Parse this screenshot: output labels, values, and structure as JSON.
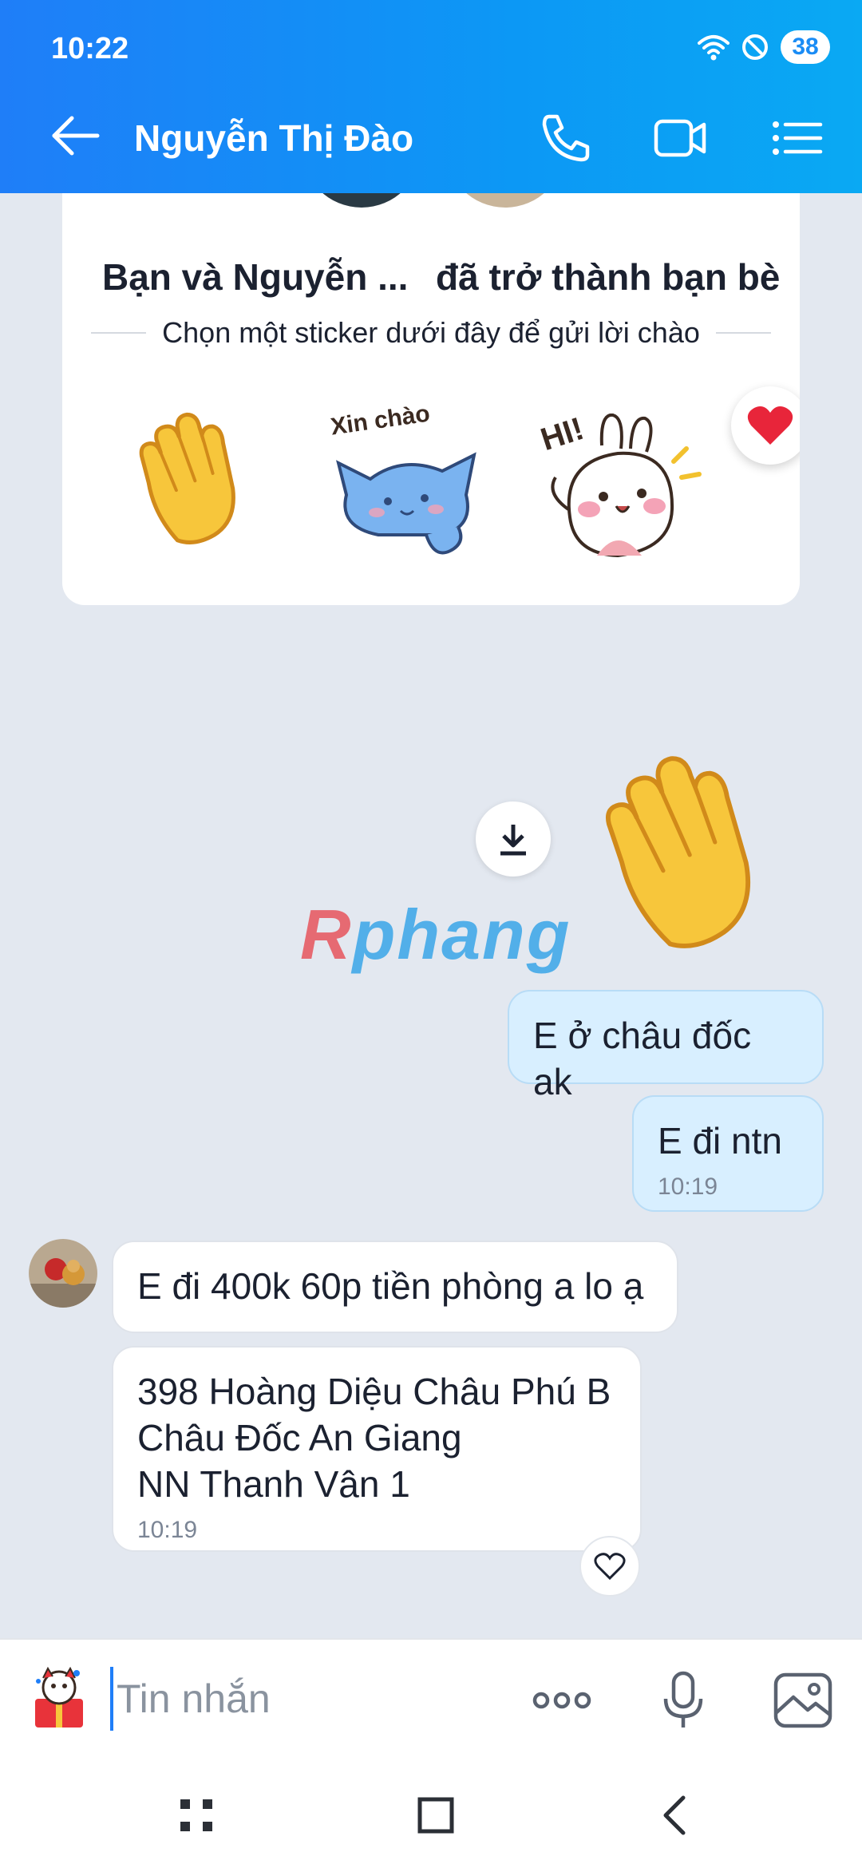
{
  "status_bar": {
    "time": "10:22",
    "battery": "38"
  },
  "header": {
    "title": "Nguyễn Thị Đào"
  },
  "greeting_card": {
    "headline_left": "Bạn và Nguyễn ...",
    "headline_right": "đã trở thành bạn bè",
    "subtitle": "Chọn một sticker dưới đây để gửi lời chào",
    "stickers": [
      {
        "name": "waving-hand",
        "text": ""
      },
      {
        "name": "xin-chao-cat",
        "text": "Xin chào"
      },
      {
        "name": "hi-bunny",
        "text": "HI!"
      }
    ]
  },
  "watermark": {
    "first": "R",
    "rest": "phang"
  },
  "messages": [
    {
      "direction": "out",
      "text": "E ở châu đốc ak",
      "time": ""
    },
    {
      "direction": "out",
      "text": "E đi ntn",
      "time": "10:19"
    },
    {
      "direction": "in",
      "text": "E đi 400k 60p tiền phòng a lo ạ",
      "time": ""
    },
    {
      "direction": "in",
      "line1": "398 Hoàng Diệu Châu Phú B",
      "line2": "Châu Đốc An Giang",
      "line3": "NN Thanh Vân 1",
      "time": "10:19"
    }
  ],
  "input": {
    "placeholder": "Tin nhắn"
  },
  "colors": {
    "header_start": "#1f7ef8",
    "header_end": "#0aa9f3",
    "outgoing_bubble": "#d8efff",
    "background": "#e3e8f0"
  },
  "icons": [
    "back-arrow-icon",
    "phone-icon",
    "video-call-icon",
    "menu-list-icon",
    "download-icon",
    "heart-icon",
    "sticker-icon",
    "more-icon",
    "microphone-icon",
    "image-icon"
  ]
}
